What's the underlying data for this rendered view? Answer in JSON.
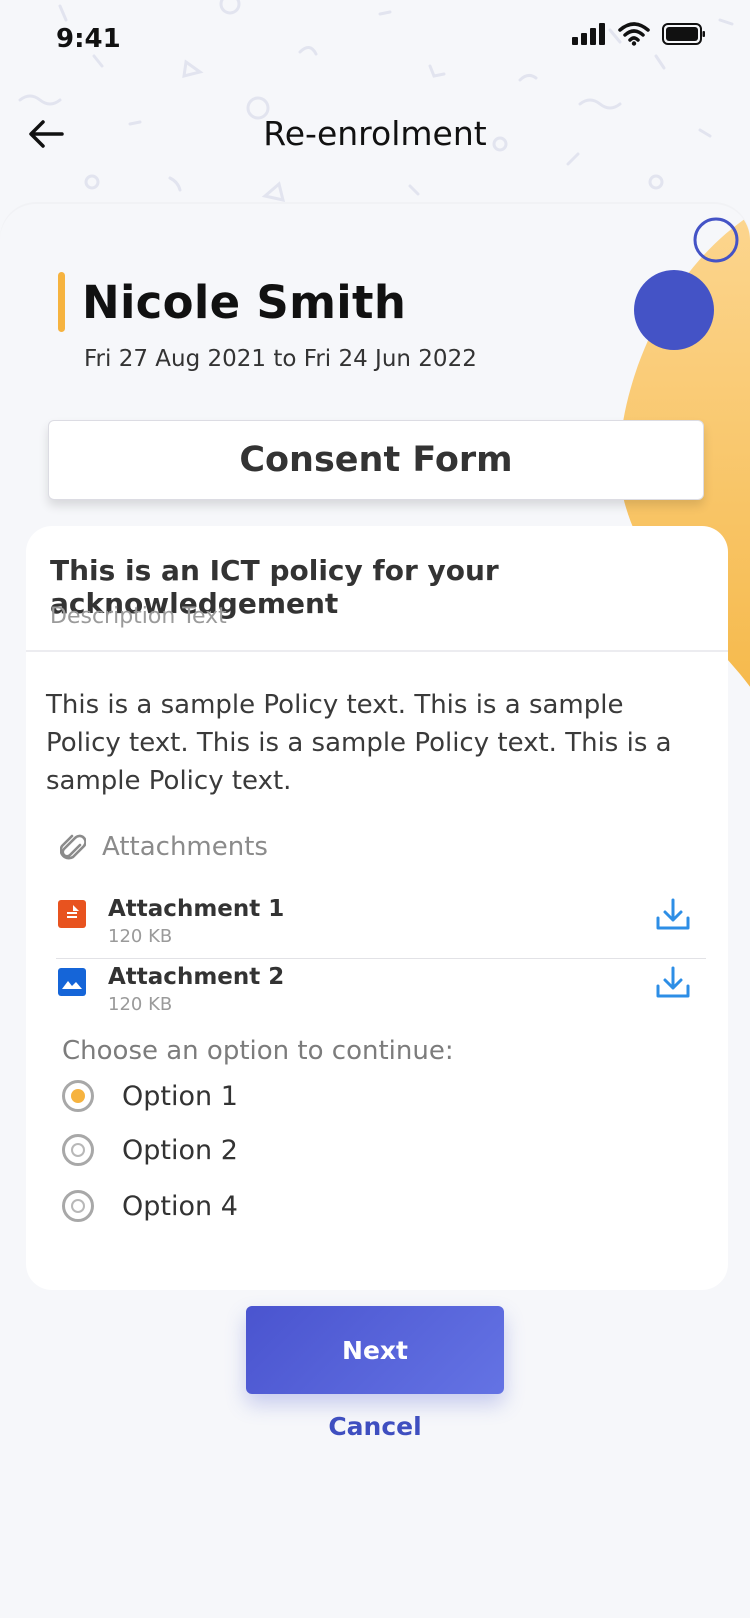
{
  "status_bar": {
    "time": "9:41"
  },
  "nav": {
    "title": "Re-enrolment"
  },
  "student": {
    "name": "Nicole Smith",
    "date_range": "Fri 27 Aug 2021 to Fri 24 Jun 2022"
  },
  "form": {
    "title": "Consent Form"
  },
  "policy": {
    "title": "This is an ICT policy for your acknowledgement",
    "description": "Description Text",
    "body": "This is a sample Policy text. This is a sample Policy text. This is a sample Policy text. This is a sample Policy text."
  },
  "attachments": {
    "label": "Attachments",
    "items": [
      {
        "name": "Attachment 1",
        "size": "120 KB",
        "icon": "document-icon",
        "color": "#e8531f"
      },
      {
        "name": "Attachment 2",
        "size": "120 KB",
        "icon": "image-icon",
        "color": "#1565d8"
      }
    ]
  },
  "choice": {
    "label": "Choose an option to continue:",
    "options": [
      {
        "label": "Option 1",
        "selected": true
      },
      {
        "label": "Option 2",
        "selected": false
      },
      {
        "label": "Option 4",
        "selected": false
      }
    ]
  },
  "actions": {
    "next_label": "Next",
    "cancel_label": "Cancel"
  },
  "colors": {
    "accent_yellow": "#f6b33f",
    "primary_blue": "#4a54cf",
    "download_blue": "#2d8ee6"
  }
}
